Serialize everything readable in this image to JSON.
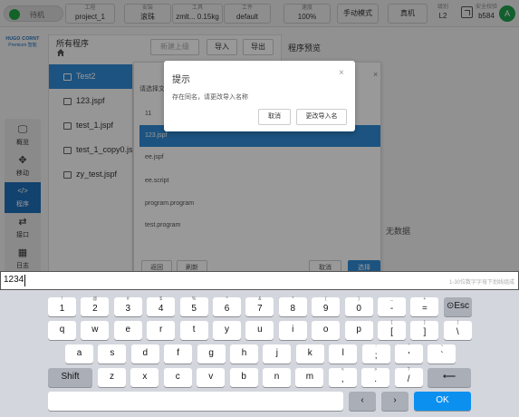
{
  "topbar": {
    "power_label": "待机",
    "cells": [
      {
        "small": "工程",
        "value": "project_1"
      },
      {
        "small": "安装",
        "value": "滚珠"
      },
      {
        "small": "工具",
        "value": "zmlt...  0.15kg"
      },
      {
        "small": "工件",
        "value": "default"
      },
      {
        "small": "速度",
        "value": "100%"
      }
    ],
    "mode_label": "手动模式",
    "real_label": "真机",
    "level_small": "级别",
    "level_value": "L2",
    "safety_small": "安全校验",
    "safety_value": "b584",
    "avatar_letter": "A"
  },
  "logo": {
    "line1": "HUGO CORNT",
    "line2": "Premium 智能"
  },
  "nav": [
    {
      "label": "概览",
      "icon": "monitor-icon",
      "glyph": "🖵"
    },
    {
      "label": "移动",
      "icon": "move-icon",
      "glyph": "✥"
    },
    {
      "label": "程序",
      "icon": "code-icon",
      "glyph": "</>"
    },
    {
      "label": "接口",
      "icon": "swap-icon",
      "glyph": "⇄"
    },
    {
      "label": "日志",
      "icon": "calendar-icon",
      "glyph": "▦"
    }
  ],
  "file_panel": {
    "title": "所有程序",
    "btn_new": "新建上级",
    "btn_import": "导入",
    "btn_export": "导出",
    "files": [
      "Test2",
      "123.jspf",
      "test_1.jspf",
      "test_1_copy0.jspf",
      "zy_test.jspf"
    ],
    "selected_index": 0
  },
  "preview": {
    "title": "程序预览",
    "empty": "无数据"
  },
  "import_dialog": {
    "title": "请选择文",
    "close": "×",
    "files": [
      "11",
      "123.jspf",
      "ee.jspf",
      "ee.script",
      "program.program",
      "test.program"
    ],
    "selected_index": 1,
    "btn_back": "返回",
    "btn_refresh": "刷新",
    "btn_cancel": "取消",
    "btn_ok": "选择"
  },
  "alert": {
    "title": "提示",
    "close": "×",
    "message": "存在同名，请更改导入名称",
    "cancel": "取消",
    "rename": "更改导入名"
  },
  "input": {
    "value": "1234",
    "hint": "1-30位数字字母下划线组成"
  },
  "keyboard": {
    "row1": [
      [
        "!",
        "1"
      ],
      [
        "@",
        "2"
      ],
      [
        "#",
        "3"
      ],
      [
        "$",
        "4"
      ],
      [
        "%",
        "5"
      ],
      [
        "^",
        "6"
      ],
      [
        "&",
        "7"
      ],
      [
        "*",
        "8"
      ],
      [
        "(",
        "9"
      ],
      [
        ")",
        "0"
      ],
      [
        "_",
        "-"
      ],
      [
        "+",
        "="
      ]
    ],
    "esc_label": "⊙Esc",
    "row2": [
      [
        "",
        "q"
      ],
      [
        "",
        "w"
      ],
      [
        "",
        "e"
      ],
      [
        "",
        "r"
      ],
      [
        "",
        "t"
      ],
      [
        "",
        "y"
      ],
      [
        "",
        "u"
      ],
      [
        "",
        "i"
      ],
      [
        "",
        "o"
      ],
      [
        "",
        "p"
      ],
      [
        "{",
        "["
      ],
      [
        "}",
        "]"
      ],
      [
        "|",
        "\\"
      ]
    ],
    "row3": [
      [
        "",
        "a"
      ],
      [
        "",
        "s"
      ],
      [
        "",
        "d"
      ],
      [
        "",
        "f"
      ],
      [
        "",
        "g"
      ],
      [
        "",
        "h"
      ],
      [
        "",
        "j"
      ],
      [
        "",
        "k"
      ],
      [
        "",
        "l"
      ],
      [
        ":",
        ";"
      ],
      [
        "\"",
        "'"
      ],
      [
        "~",
        "`"
      ]
    ],
    "shift_label": "Shift",
    "row4": [
      [
        "",
        "z"
      ],
      [
        "",
        "x"
      ],
      [
        "",
        "c"
      ],
      [
        "",
        "v"
      ],
      [
        "",
        "b"
      ],
      [
        "",
        "n"
      ],
      [
        "",
        "m"
      ],
      [
        "<",
        ","
      ],
      [
        ">",
        "."
      ],
      [
        "?",
        "/"
      ]
    ],
    "backspace_label": "⟵",
    "left_label": "‹",
    "right_label": "›",
    "ok_label": "OK"
  }
}
